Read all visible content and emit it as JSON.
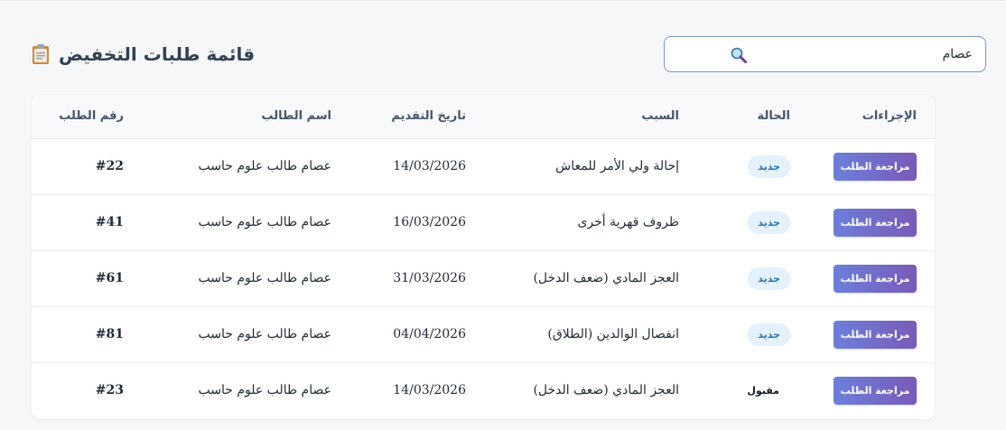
{
  "header": {
    "title": "قائمة طلبات التخفيض"
  },
  "search": {
    "value": "عصام",
    "placeholder": ""
  },
  "table": {
    "columns": {
      "id": "رقم الطلب",
      "name": "اسم الطالب",
      "date": "تاريخ التقديم",
      "reason": "السبب",
      "status": "الحالة",
      "actions": "الإجراءات"
    },
    "rows": [
      {
        "id": "#22",
        "name": "عصام طالب علوم حاسب",
        "date": "14/03/2026",
        "reason": "إحالة ولي الأمر للمعاش",
        "status": "جديد",
        "status_type": "new",
        "action": "مراجعة الطلب"
      },
      {
        "id": "#41",
        "name": "عصام طالب علوم حاسب",
        "date": "16/03/2026",
        "reason": "ظروف قهرية أخرى",
        "status": "جديد",
        "status_type": "new",
        "action": "مراجعة الطلب"
      },
      {
        "id": "#61",
        "name": "عصام طالب علوم حاسب",
        "date": "31/03/2026",
        "reason": "العجز المادي (ضعف الدخل)",
        "status": "جديد",
        "status_type": "new",
        "action": "مراجعة الطلب"
      },
      {
        "id": "#81",
        "name": "عصام طالب علوم حاسب",
        "date": "04/04/2026",
        "reason": "انفصال الوالدين (الطلاق)",
        "status": "جديد",
        "status_type": "new",
        "action": "مراجعة الطلب"
      },
      {
        "id": "#23",
        "name": "عصام طالب علوم حاسب",
        "date": "14/03/2026",
        "reason": "العجز المادي (ضعف الدخل)",
        "status": "مقبول",
        "status_type": "accepted",
        "action": "مراجعة الطلب"
      }
    ]
  },
  "icons": {
    "title_icon": "clipboard-icon",
    "search_icon": "magnifier-icon"
  },
  "colors": {
    "accent_start": "#6b7fdb",
    "accent_end": "#7a5bb8",
    "badge_bg": "#e4f2fd",
    "badge_text": "#2f6fad"
  }
}
